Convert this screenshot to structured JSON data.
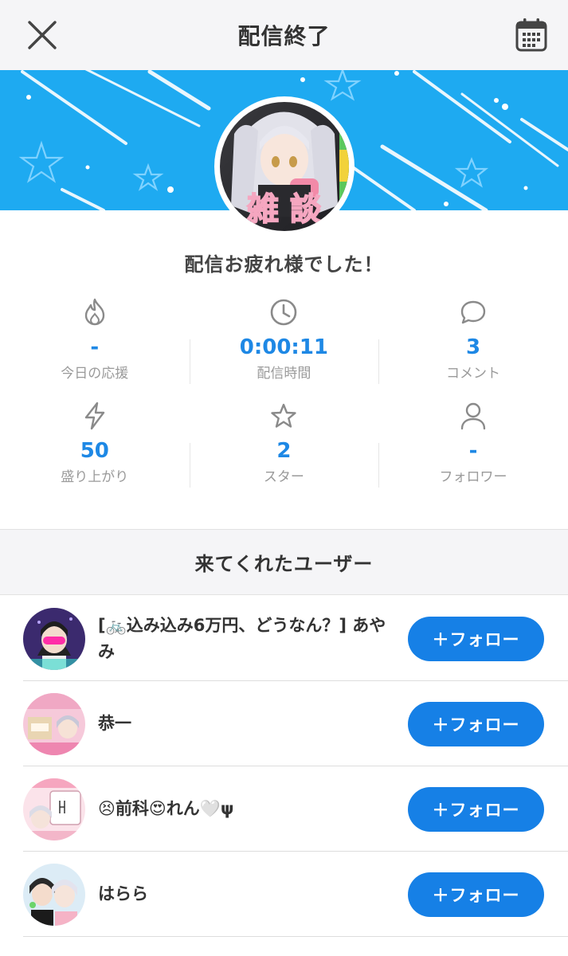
{
  "header": {
    "title": "配信終了",
    "close_icon": "close-icon",
    "calendar_icon": "calendar-icon"
  },
  "colors": {
    "accent": "#1680e6",
    "value_text": "#1e88e5",
    "banner": "#1eaaf1"
  },
  "done_message": "配信お疲れ様でした！",
  "stats": [
    {
      "icon": "flame-icon",
      "value": "-",
      "label": "今日の応援"
    },
    {
      "icon": "clock-icon",
      "value": "0:00:11",
      "label": "配信時間"
    },
    {
      "icon": "comment-icon",
      "value": "3",
      "label": "コメント"
    },
    {
      "icon": "lightning-icon",
      "value": "50",
      "label": "盛り上がり"
    },
    {
      "icon": "star-icon",
      "value": "2",
      "label": "スター"
    },
    {
      "icon": "person-icon",
      "value": "-",
      "label": "フォロワー"
    }
  ],
  "visitors": {
    "title": "来てくれたユーザー",
    "follow_label": "＋フォロー",
    "users": [
      {
        "name": "[🚲込み込み6万円、どうなん？] あやみ"
      },
      {
        "name": "恭一"
      },
      {
        "name": "😣前科😍れん🤍ψ"
      },
      {
        "name": "はらら"
      }
    ]
  }
}
